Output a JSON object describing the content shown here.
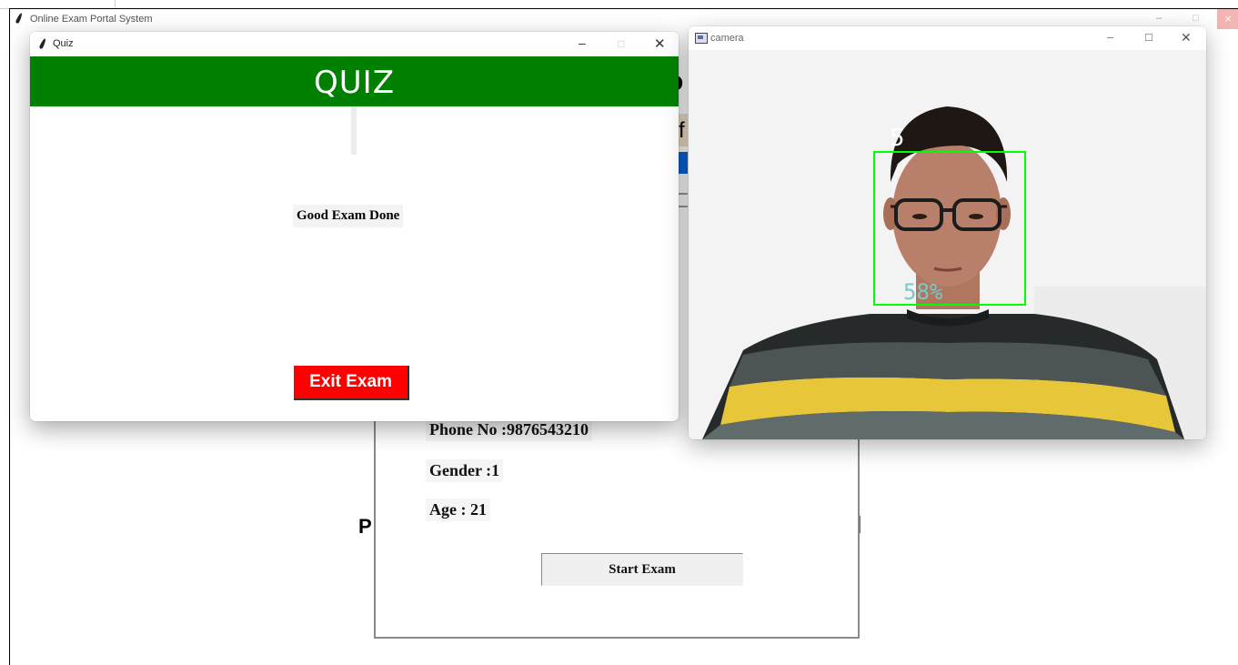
{
  "main_window": {
    "title": "Online Exam Portal System",
    "min_glyph": "–",
    "max_glyph": "□",
    "close_glyph": "×"
  },
  "behind_fragments": {
    "heading_fragment": "o",
    "line_fragment": "f",
    "left_fragment": "P"
  },
  "details": {
    "phone": "Phone No :9876543210",
    "gender": "Gender :1",
    "age": "Age :  21",
    "start_button": "Start Exam"
  },
  "quiz_window": {
    "title": "Quiz",
    "min_glyph": "–",
    "max_glyph": "□",
    "close_glyph": "✕",
    "heading": "QUIZ",
    "result_text": "Good Exam Done",
    "exit_button": "Exit Exam",
    "colors": {
      "header": "#008000",
      "exit_button": "#ff0000"
    }
  },
  "camera_window": {
    "title": "camera",
    "min_glyph": "–",
    "max_glyph": "□",
    "close_glyph": "✕",
    "face_label": "5",
    "confidence": "58%",
    "colors": {
      "face_box": "#00ff00",
      "confidence_text": "#7ac9c9"
    }
  }
}
